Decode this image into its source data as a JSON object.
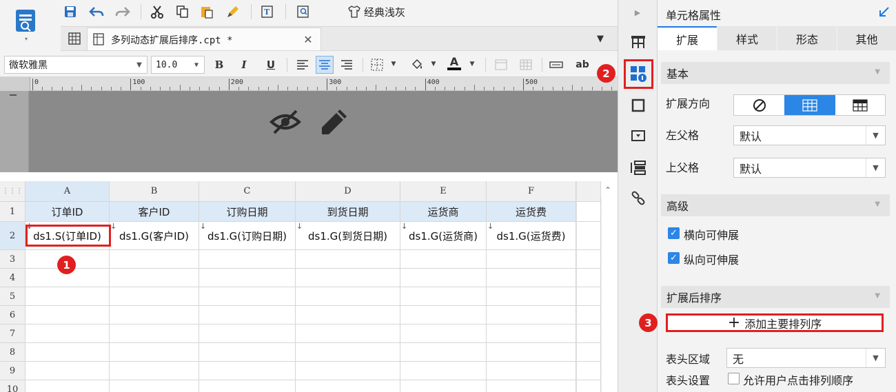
{
  "toolbar": {
    "theme_label": "经典浅灰",
    "file_tab": "多列动态扩展后排序.cpt *",
    "font_name": "微软雅黑",
    "font_size": "10.0",
    "bold": "B",
    "italic": "I",
    "underline": "U",
    "font_color": "A",
    "ab": "ab"
  },
  "ruler": {
    "ticks": [
      "0",
      "100",
      "200",
      "300",
      "400",
      "500"
    ]
  },
  "grid": {
    "columns": [
      "A",
      "B",
      "C",
      "D",
      "E",
      "F"
    ],
    "rows": [
      "1",
      "2",
      "3",
      "4",
      "5",
      "6",
      "7",
      "8",
      "9",
      "10"
    ],
    "header_row": [
      "订单ID",
      "客户ID",
      "订购日期",
      "到货日期",
      "运货商",
      "运货费"
    ],
    "data_row": [
      "ds1.S(订单ID)",
      "ds1.G(客户ID)",
      "ds1.G(订购日期)",
      "ds1.G(到货日期)",
      "ds1.G(运货商)",
      "ds1.G(运货费)"
    ],
    "selected_cell": "A2"
  },
  "badges": {
    "one": "1",
    "two": "2",
    "three": "3"
  },
  "panel": {
    "title": "单元格属性",
    "tabs": [
      "扩展",
      "样式",
      "形态",
      "其他"
    ],
    "basic_section": "基本",
    "expand_direction_label": "扩展方向",
    "left_parent_label": "左父格",
    "left_parent_value": "默认",
    "upper_parent_label": "上父格",
    "upper_parent_value": "默认",
    "advanced_section": "高级",
    "horizontal_expandable": "横向可伸展",
    "vertical_expandable": "纵向可伸展",
    "sort_section": "扩展后排序",
    "add_sort_button": "添加主要排列序",
    "header_area_label": "表头区域",
    "header_area_value": "无",
    "header_setting_label": "表头设置",
    "allow_user_sort": "允许用户点击排列顺序"
  },
  "colors": {
    "accent": "#1e7ae0",
    "badge_red": "#e02020",
    "header_blue": "#dce9f7"
  }
}
